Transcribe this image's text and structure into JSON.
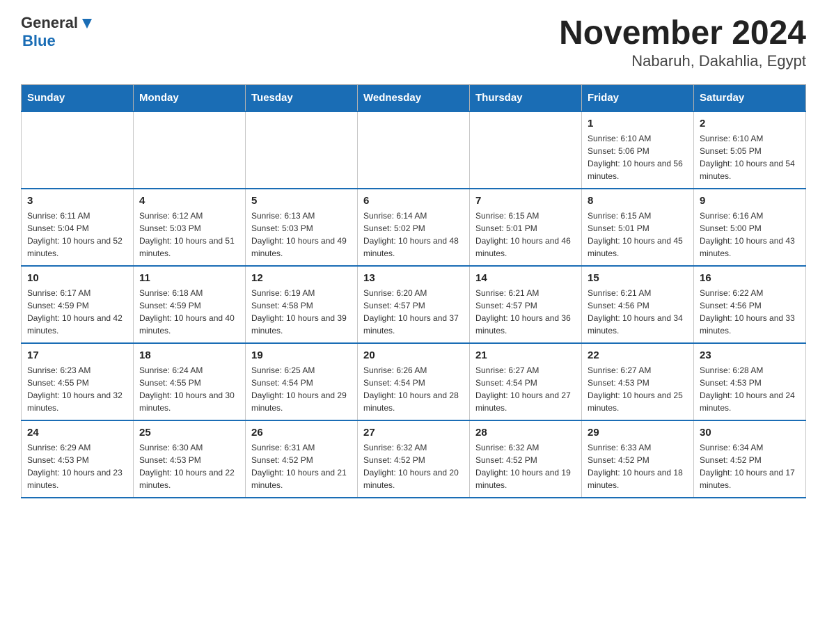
{
  "header": {
    "logo_general": "General",
    "logo_blue": "Blue",
    "title": "November 2024",
    "subtitle": "Nabaruh, Dakahlia, Egypt"
  },
  "weekdays": [
    "Sunday",
    "Monday",
    "Tuesday",
    "Wednesday",
    "Thursday",
    "Friday",
    "Saturday"
  ],
  "weeks": [
    [
      {
        "day": "",
        "info": ""
      },
      {
        "day": "",
        "info": ""
      },
      {
        "day": "",
        "info": ""
      },
      {
        "day": "",
        "info": ""
      },
      {
        "day": "",
        "info": ""
      },
      {
        "day": "1",
        "info": "Sunrise: 6:10 AM\nSunset: 5:06 PM\nDaylight: 10 hours and 56 minutes."
      },
      {
        "day": "2",
        "info": "Sunrise: 6:10 AM\nSunset: 5:05 PM\nDaylight: 10 hours and 54 minutes."
      }
    ],
    [
      {
        "day": "3",
        "info": "Sunrise: 6:11 AM\nSunset: 5:04 PM\nDaylight: 10 hours and 52 minutes."
      },
      {
        "day": "4",
        "info": "Sunrise: 6:12 AM\nSunset: 5:03 PM\nDaylight: 10 hours and 51 minutes."
      },
      {
        "day": "5",
        "info": "Sunrise: 6:13 AM\nSunset: 5:03 PM\nDaylight: 10 hours and 49 minutes."
      },
      {
        "day": "6",
        "info": "Sunrise: 6:14 AM\nSunset: 5:02 PM\nDaylight: 10 hours and 48 minutes."
      },
      {
        "day": "7",
        "info": "Sunrise: 6:15 AM\nSunset: 5:01 PM\nDaylight: 10 hours and 46 minutes."
      },
      {
        "day": "8",
        "info": "Sunrise: 6:15 AM\nSunset: 5:01 PM\nDaylight: 10 hours and 45 minutes."
      },
      {
        "day": "9",
        "info": "Sunrise: 6:16 AM\nSunset: 5:00 PM\nDaylight: 10 hours and 43 minutes."
      }
    ],
    [
      {
        "day": "10",
        "info": "Sunrise: 6:17 AM\nSunset: 4:59 PM\nDaylight: 10 hours and 42 minutes."
      },
      {
        "day": "11",
        "info": "Sunrise: 6:18 AM\nSunset: 4:59 PM\nDaylight: 10 hours and 40 minutes."
      },
      {
        "day": "12",
        "info": "Sunrise: 6:19 AM\nSunset: 4:58 PM\nDaylight: 10 hours and 39 minutes."
      },
      {
        "day": "13",
        "info": "Sunrise: 6:20 AM\nSunset: 4:57 PM\nDaylight: 10 hours and 37 minutes."
      },
      {
        "day": "14",
        "info": "Sunrise: 6:21 AM\nSunset: 4:57 PM\nDaylight: 10 hours and 36 minutes."
      },
      {
        "day": "15",
        "info": "Sunrise: 6:21 AM\nSunset: 4:56 PM\nDaylight: 10 hours and 34 minutes."
      },
      {
        "day": "16",
        "info": "Sunrise: 6:22 AM\nSunset: 4:56 PM\nDaylight: 10 hours and 33 minutes."
      }
    ],
    [
      {
        "day": "17",
        "info": "Sunrise: 6:23 AM\nSunset: 4:55 PM\nDaylight: 10 hours and 32 minutes."
      },
      {
        "day": "18",
        "info": "Sunrise: 6:24 AM\nSunset: 4:55 PM\nDaylight: 10 hours and 30 minutes."
      },
      {
        "day": "19",
        "info": "Sunrise: 6:25 AM\nSunset: 4:54 PM\nDaylight: 10 hours and 29 minutes."
      },
      {
        "day": "20",
        "info": "Sunrise: 6:26 AM\nSunset: 4:54 PM\nDaylight: 10 hours and 28 minutes."
      },
      {
        "day": "21",
        "info": "Sunrise: 6:27 AM\nSunset: 4:54 PM\nDaylight: 10 hours and 27 minutes."
      },
      {
        "day": "22",
        "info": "Sunrise: 6:27 AM\nSunset: 4:53 PM\nDaylight: 10 hours and 25 minutes."
      },
      {
        "day": "23",
        "info": "Sunrise: 6:28 AM\nSunset: 4:53 PM\nDaylight: 10 hours and 24 minutes."
      }
    ],
    [
      {
        "day": "24",
        "info": "Sunrise: 6:29 AM\nSunset: 4:53 PM\nDaylight: 10 hours and 23 minutes."
      },
      {
        "day": "25",
        "info": "Sunrise: 6:30 AM\nSunset: 4:53 PM\nDaylight: 10 hours and 22 minutes."
      },
      {
        "day": "26",
        "info": "Sunrise: 6:31 AM\nSunset: 4:52 PM\nDaylight: 10 hours and 21 minutes."
      },
      {
        "day": "27",
        "info": "Sunrise: 6:32 AM\nSunset: 4:52 PM\nDaylight: 10 hours and 20 minutes."
      },
      {
        "day": "28",
        "info": "Sunrise: 6:32 AM\nSunset: 4:52 PM\nDaylight: 10 hours and 19 minutes."
      },
      {
        "day": "29",
        "info": "Sunrise: 6:33 AM\nSunset: 4:52 PM\nDaylight: 10 hours and 18 minutes."
      },
      {
        "day": "30",
        "info": "Sunrise: 6:34 AM\nSunset: 4:52 PM\nDaylight: 10 hours and 17 minutes."
      }
    ]
  ]
}
